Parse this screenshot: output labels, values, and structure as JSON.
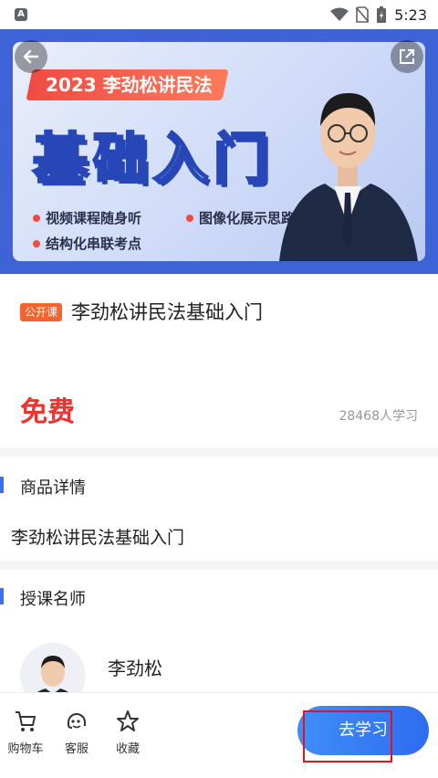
{
  "status_bar": {
    "time": "5:23",
    "app_badge": "A"
  },
  "banner": {
    "title": "2023 李劲松讲民法",
    "big_title": "基础入门",
    "features": [
      "视频课程随身听",
      "图像化展示思路",
      "结构化串联考点"
    ]
  },
  "course": {
    "tag": "公开课",
    "title": "李劲松讲民法基础入门",
    "price": "免费",
    "learners": "28468人学习"
  },
  "details": {
    "heading": "商品详情",
    "text": "李劲松讲民法基础入门"
  },
  "teacher": {
    "heading": "授课名师",
    "name": "李劲松"
  },
  "bottom_bar": {
    "items": [
      {
        "label": "购物车",
        "icon": "cart-icon"
      },
      {
        "label": "客服",
        "icon": "customer-service-icon"
      },
      {
        "label": "收藏",
        "icon": "star-icon"
      }
    ],
    "primary_button": "去学习"
  },
  "colors": {
    "accent_blue": "#3b6ff2",
    "price_red": "#f0312d",
    "tag_orange": "#f4622e",
    "highlight_red": "#e0141b"
  }
}
